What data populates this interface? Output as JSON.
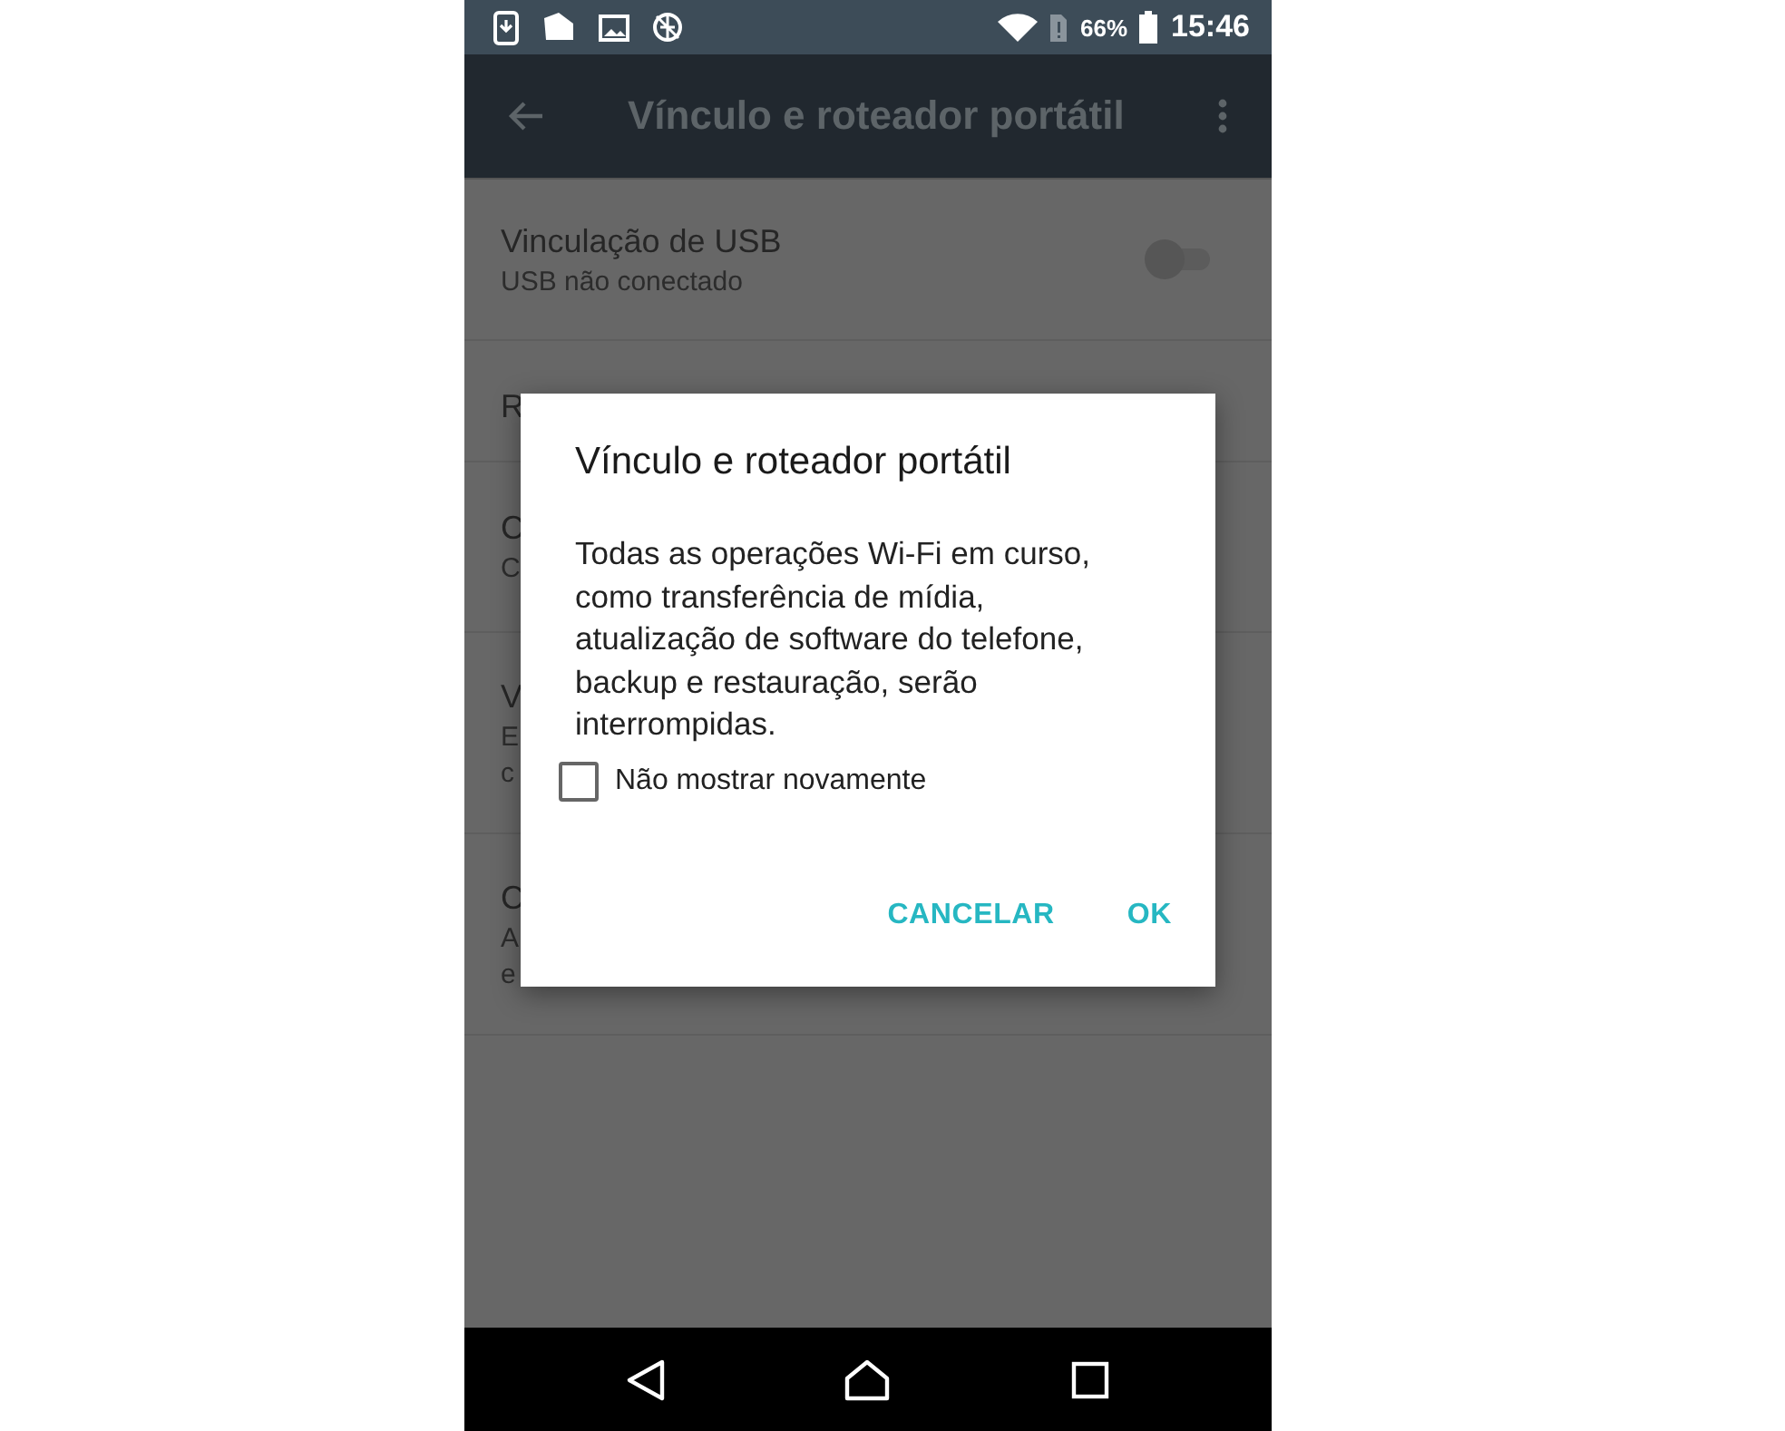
{
  "status_bar": {
    "battery": "66%",
    "time": "15:46"
  },
  "app_bar": {
    "title": "Vínculo e roteador portátil"
  },
  "settings": [
    {
      "lines": [
        "Vinculação de USB",
        "USB não conectado"
      ],
      "toggle": {
        "on": false
      }
    },
    {
      "lines": [
        "R"
      ]
    },
    {
      "lines": [
        "C",
        "C"
      ]
    },
    {
      "lines": [
        "V",
        "E",
        "c"
      ]
    },
    {
      "lines": [
        "C",
        "A",
        "e"
      ]
    }
  ],
  "dialog": {
    "title": "Vínculo e roteador portátil",
    "message": "Todas as operações Wi-Fi em curso, como transferência de mídia, atualização de software do telefone, backup e restauração, serão interrompidas.",
    "checkbox": {
      "label": "Não mostrar novamente",
      "checked": false
    },
    "buttons": [
      "CANCELAR",
      "OK"
    ]
  }
}
